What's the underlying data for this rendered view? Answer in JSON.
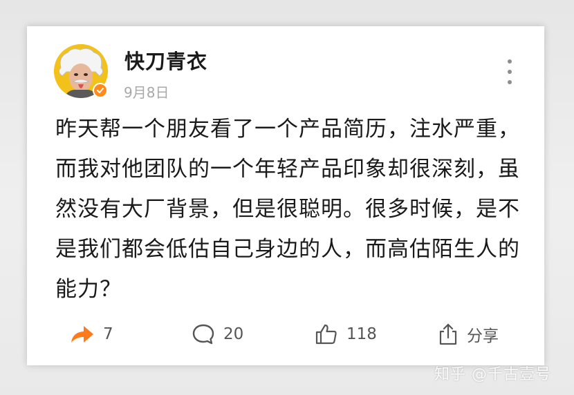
{
  "post": {
    "author": "快刀青衣",
    "date": "9月8日",
    "body": "昨天帮一个朋友看了一个产品简历，注水严重，而我对他团队的一个年轻产品印象却很深刻，虽然没有大厂背景，但是很聪明。很多时候，是不是我们都会低估自己身边的人，而高估陌生人的能力？"
  },
  "actions": {
    "repost_count": "7",
    "comment_count": "20",
    "like_count": "118",
    "share_label": "分享"
  },
  "icons": {
    "repost": "repost-arrow-icon",
    "comment": "comment-bubble-icon",
    "like": "thumbs-up-icon",
    "share": "share-icon",
    "more": "more-vertical-icon",
    "verified": "verified-badge-icon"
  },
  "colors": {
    "accent": "#ff8c1a",
    "avatar_bg": "#f3c21a",
    "text": "#1a1a1a",
    "muted": "#a8a8a8"
  },
  "watermark": "知乎 @千古壹号"
}
